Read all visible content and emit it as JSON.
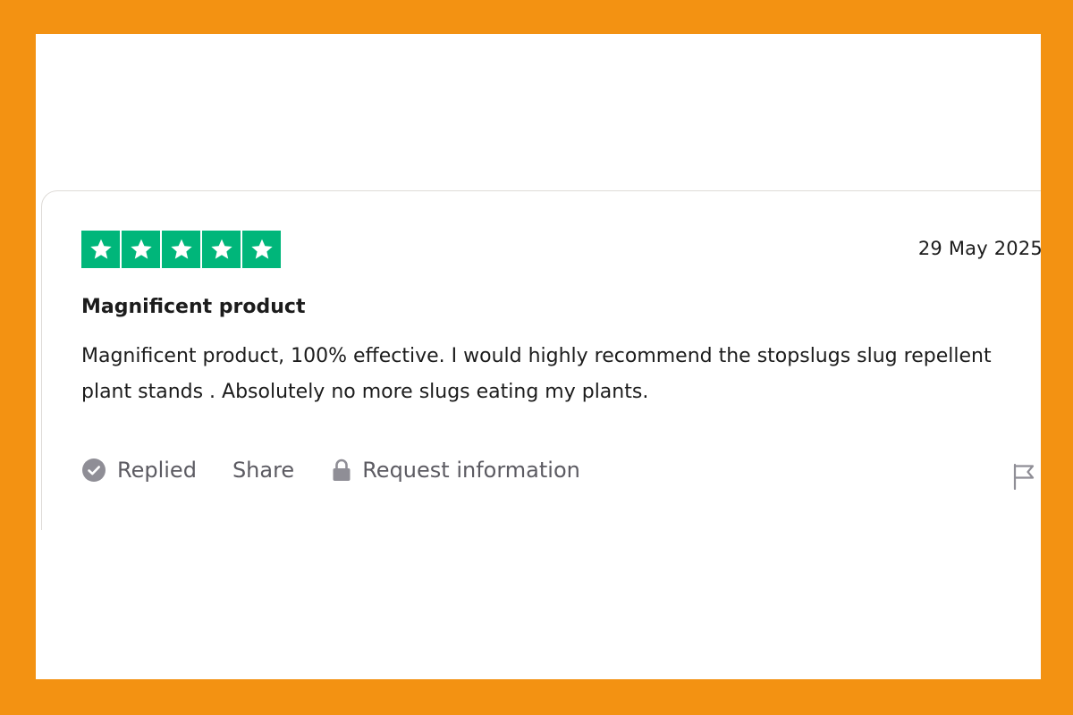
{
  "colors": {
    "border_frame": "#f39212",
    "star_green": "#00b67a",
    "text_dark": "#1c1c1c",
    "text_muted": "#5c5b62",
    "icon_gray": "#8f8e96"
  },
  "review": {
    "rating": 5,
    "rating_max": 5,
    "date": "29 May 2025",
    "title": "Magnificent product",
    "body": "Magnificent product, 100% effective. I would highly recommend the stopslugs slug repellent plant stands . Absolutely no more slugs eating my plants."
  },
  "actions": {
    "replied_label": "Replied",
    "replied_icon": "check-circle-icon",
    "share_label": "Share",
    "request_label": "Request information",
    "request_icon": "lock-icon",
    "report_icon": "flag-icon"
  }
}
